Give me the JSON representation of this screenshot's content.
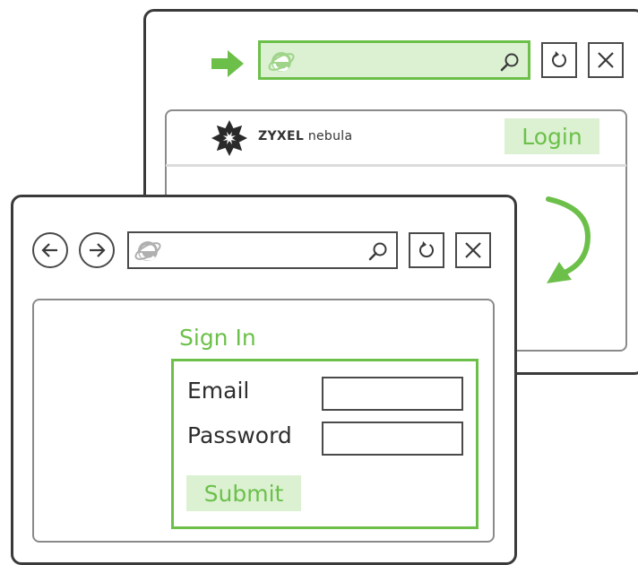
{
  "back_browser": {
    "icons": {
      "ie": "internet-explorer-icon",
      "search": "search-icon",
      "refresh": "refresh-icon",
      "close": "close-icon",
      "pointer": "arrow-right-icon"
    },
    "brand": {
      "name_bold": "ZYXEL",
      "name_light": "nebula",
      "logo": "zyxel-nebula-logo"
    },
    "login_label": "Login"
  },
  "front_browser": {
    "icons": {
      "back": "arrow-left-icon",
      "forward": "arrow-right-icon",
      "ie": "internet-explorer-icon",
      "search": "search-icon",
      "refresh": "refresh-icon",
      "close": "close-icon"
    },
    "signin": {
      "title": "Sign In",
      "email_label": "Email",
      "email_value": "",
      "password_label": "Password",
      "password_value": "",
      "submit_label": "Submit"
    }
  },
  "connector": {
    "icon": "curved-arrow-icon"
  },
  "colors": {
    "accent": "#6cc04a",
    "accent_light": "#dbf1d2",
    "outline": "#3a3a3a",
    "inner_border": "#8a8a8a"
  }
}
